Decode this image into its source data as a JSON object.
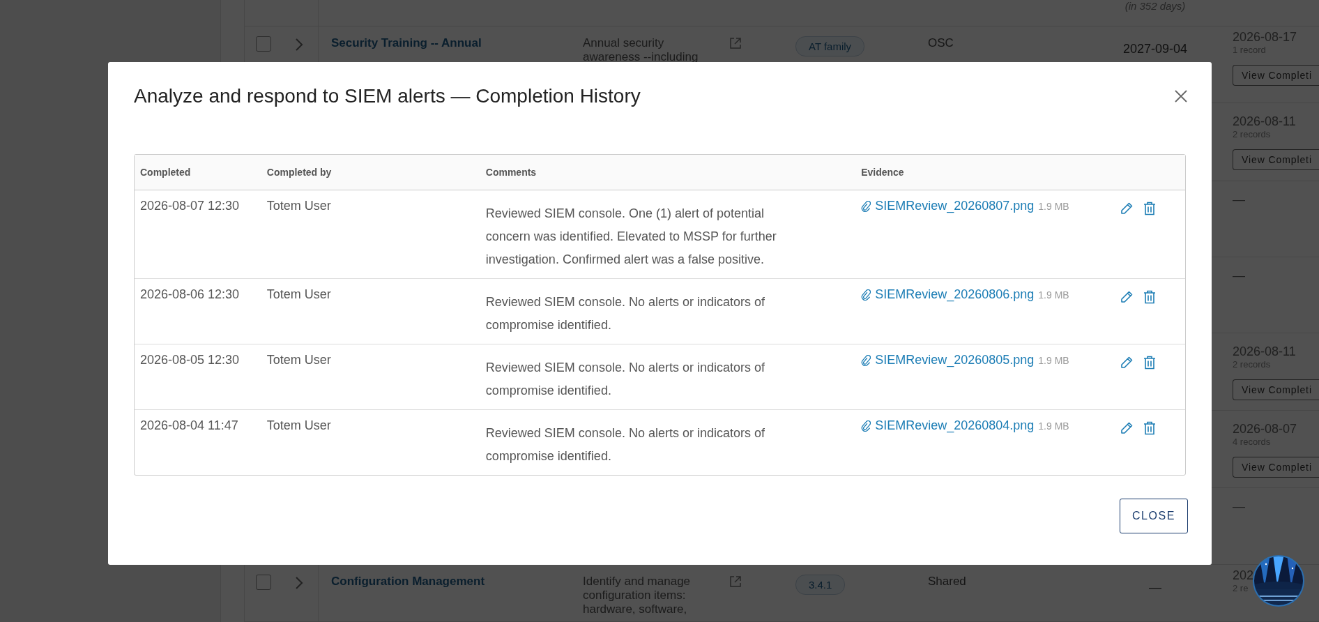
{
  "background_table": {
    "rows": [
      {
        "due_note": "(in 352 days)"
      },
      {
        "checked": false,
        "name": "Security Training -- Annual",
        "description": "Annual security awareness --including",
        "tag": "AT family",
        "owner": "OSC",
        "due": "2027-09-04",
        "last_completed": "2026-08-17",
        "record_count": "1 record",
        "button": "View Completi"
      },
      {
        "last_completed": "2026-08-11",
        "record_count": "2 records",
        "button": "View Completi"
      },
      {
        "last_completed": "—"
      },
      {
        "last_completed": "—"
      },
      {
        "last_completed": "2026-08-11",
        "record_count": "2 records",
        "button": "View Completi"
      },
      {
        "last_completed": "2026-08-07",
        "record_count": "4 records",
        "button": "View Completi"
      },
      {
        "last_completed": "—"
      },
      {
        "checked": false,
        "name": "Configuration Management",
        "description": "Identify and manage configuration items: hardware, software,",
        "tag": "3.4.1",
        "owner": "Shared",
        "due": "—",
        "last_completed": "202",
        "record_count": "2 re"
      }
    ]
  },
  "modal": {
    "title": "Analyze and respond to SIEM alerts — Completion History",
    "columns": [
      "Completed",
      "Completed by",
      "Comments",
      "Evidence"
    ],
    "rows": [
      {
        "completed": "2026-08-07 12:30",
        "completed_by": "Totem User",
        "comments": "Reviewed SIEM console. One (1) alert of potential concern was identified. Elevated to MSSP for further investigation. Confirmed alert was a false positive.",
        "file": "SIEMReview_20260807.png",
        "size": "1.9 MB"
      },
      {
        "completed": "2026-08-06 12:30",
        "completed_by": "Totem User",
        "comments": "Reviewed SIEM console. No alerts or indicators of compromise identified.",
        "file": "SIEMReview_20260806.png",
        "size": "1.9 MB"
      },
      {
        "completed": "2026-08-05 12:30",
        "completed_by": "Totem User",
        "comments": "Reviewed SIEM console. No alerts or indicators of compromise identified.",
        "file": "SIEMReview_20260805.png",
        "size": "1.9 MB"
      },
      {
        "completed": "2026-08-04 11:47",
        "completed_by": "Totem User",
        "comments": "Reviewed SIEM console. No alerts or indicators of compromise identified.",
        "file": "SIEMReview_20260804.png",
        "size": "1.9 MB"
      }
    ],
    "close_button": "CLOSE"
  }
}
